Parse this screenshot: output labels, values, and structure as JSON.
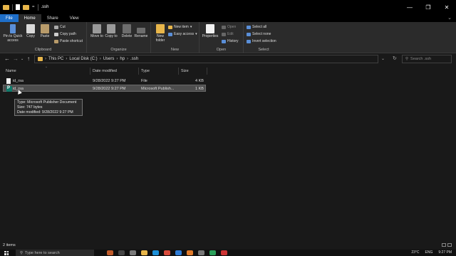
{
  "window": {
    "title": ".ssh",
    "quick_access_dropdown": "="
  },
  "controls": {
    "minimize": "—",
    "maximize": "❐",
    "close": "✕"
  },
  "tabs": [
    {
      "label": "File"
    },
    {
      "label": "Home"
    },
    {
      "label": "Share"
    },
    {
      "label": "View"
    }
  ],
  "ribbon": {
    "clipboard": {
      "label": "Clipboard",
      "pin": "Pin to Quick access",
      "copy": "Copy",
      "paste": "Paste",
      "cut": "Cut",
      "copy_path": "Copy path",
      "paste_shortcut": "Paste shortcut"
    },
    "organize": {
      "label": "Organize",
      "move_to": "Move to",
      "copy_to": "Copy to",
      "delete": "Delete",
      "rename": "Rename"
    },
    "new": {
      "label": "New",
      "new_folder": "New folder",
      "new_item": "New item",
      "easy_access": "Easy access"
    },
    "open": {
      "label": "Open",
      "properties": "Properties",
      "open": "Open",
      "edit": "Edit",
      "history": "History"
    },
    "select": {
      "label": "Select",
      "select_all": "Select all",
      "select_none": "Select none",
      "invert_selection": "Invert selection"
    }
  },
  "address": {
    "crumbs": [
      "This PC",
      "Local Disk (C:)",
      "Users",
      "hp",
      ".ssh"
    ],
    "search_placeholder": "Search .ssh"
  },
  "columns": {
    "name": "Name",
    "date": "Date modified",
    "type": "Type",
    "size": "Size"
  },
  "files": [
    {
      "name": "id_rsa",
      "date": "9/28/2022 9:27 PM",
      "type": "File",
      "size": "4 KB"
    },
    {
      "name": "id_rsa",
      "date": "9/28/2022 9:27 PM",
      "type": "Microsoft Publish...",
      "size": "1 KB"
    }
  ],
  "tooltip": {
    "type": "Type: Microsoft Publisher Document",
    "size": "Size: 747 bytes",
    "date": "Date modified: 9/28/2022 9:27 PM"
  },
  "status": {
    "items": "2 items"
  },
  "taskbar": {
    "search": "Type here to search",
    "weather": "23°C",
    "lang": "ENG",
    "time": "9:27 PM"
  }
}
